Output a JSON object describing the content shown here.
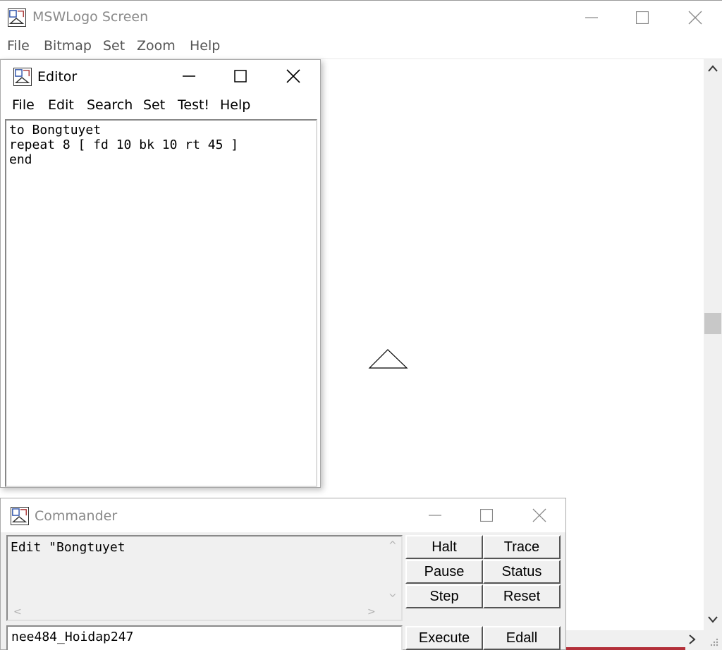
{
  "main_window": {
    "title": "MSWLogo Screen",
    "menu": [
      "File",
      "Bitmap",
      "Set",
      "Zoom",
      "Help"
    ],
    "icons": {
      "minimize": "minimize-icon",
      "maximize": "maximize-icon",
      "close": "close-icon"
    }
  },
  "editor": {
    "title": "Editor",
    "menu": [
      "File",
      "Edit",
      "Search",
      "Set",
      "Test!",
      "Help"
    ],
    "content": "to Bongtuyet\nrepeat 8 [ fd 10 bk 10 rt 45 ]\nend"
  },
  "commander": {
    "title": "Commander",
    "history": "Edit \"Bongtuyet",
    "input_value": "nee484_Hoidap247",
    "buttons": {
      "halt": "Halt",
      "trace": "Trace",
      "pause": "Pause",
      "status": "Status",
      "step": "Step",
      "reset": "Reset",
      "execute": "Execute",
      "edall": "Edall"
    }
  },
  "colors": {
    "accent_red": "#b3303a",
    "dialog_bg": "#f0f0f0"
  }
}
